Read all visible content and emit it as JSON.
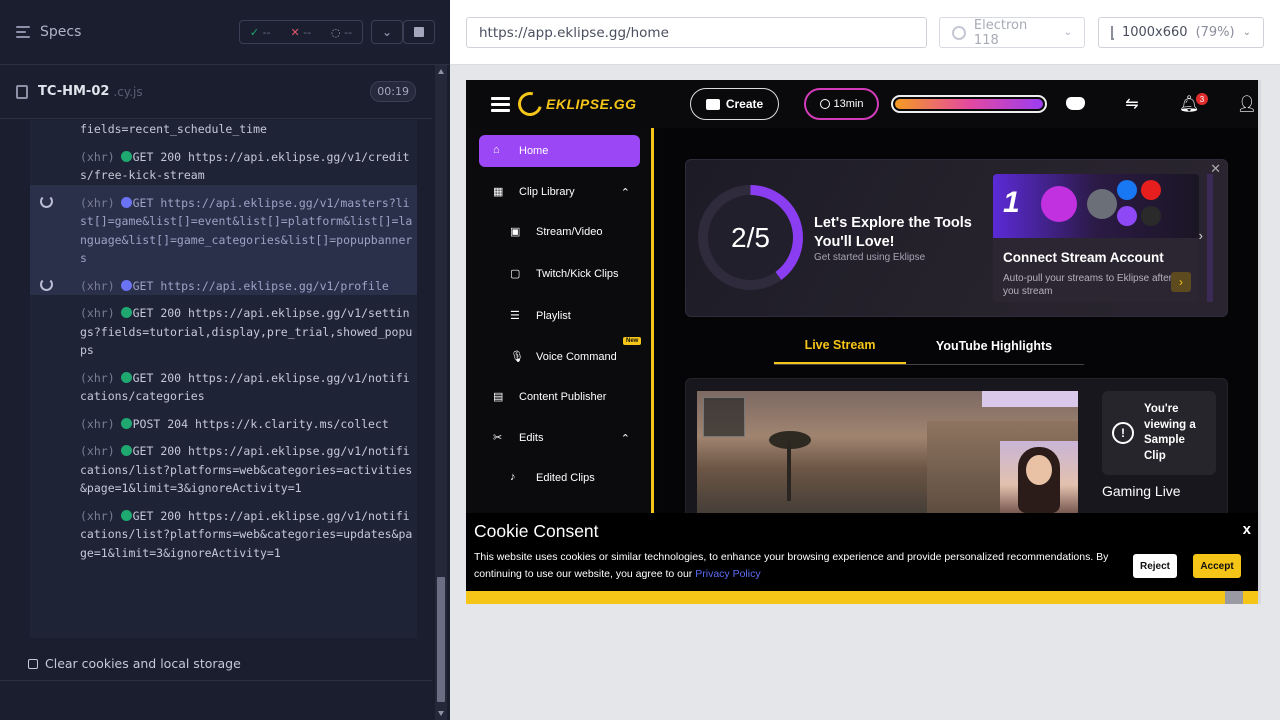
{
  "runner": {
    "specs_label": "Specs",
    "stats": {
      "passed": "--",
      "failed": "--",
      "pending": "--"
    },
    "spec_name": "TC-HM-02",
    "spec_ext": ".cy.js",
    "duration": "00:19",
    "clear_label": "Clear cookies and local storage",
    "logs": [
      {
        "kind": "",
        "status": "",
        "text": "fields=recent_schedule_time",
        "pending": false,
        "continuation": true
      },
      {
        "kind": "(xhr)",
        "status": "GET 200",
        "text": "https://api.eklipse.gg/v1/credits/free-kick-stream",
        "pending": false
      },
      {
        "kind": "(xhr)",
        "status": "GET",
        "text": "https://api.eklipse.gg/v1/masters?list[]=game&list[]=event&list[]=platform&list[]=language&list[]=game_categories&list[]=popupbanners",
        "pending": true
      },
      {
        "kind": "(xhr)",
        "status": "GET",
        "text": "https://api.eklipse.gg/v1/profile",
        "pending": true
      },
      {
        "kind": "(xhr)",
        "status": "GET 200",
        "text": "https://api.eklipse.gg/v1/settings?fields=tutorial,display,pre_trial,showed_popups",
        "pending": false
      },
      {
        "kind": "(xhr)",
        "status": "GET 200",
        "text": "https://api.eklipse.gg/v1/notifications/categories",
        "pending": false
      },
      {
        "kind": "(xhr)",
        "status": "POST 204",
        "text": "https://k.clarity.ms/collect",
        "pending": false
      },
      {
        "kind": "(xhr)",
        "status": "GET 200",
        "text": "https://api.eklipse.gg/v1/notifications/list?platforms=web&categories=activities&page=1&limit=3&ignoreActivity=1",
        "pending": false
      },
      {
        "kind": "(xhr)",
        "status": "GET 200",
        "text": "https://api.eklipse.gg/v1/notifications/list?platforms=web&categories=updates&page=1&limit=3&ignoreActivity=1",
        "pending": false
      }
    ]
  },
  "aut": {
    "url": "https://app.eklipse.gg/home",
    "browser": "Electron 118",
    "viewport": "1000x660",
    "zoom": "(79%)"
  },
  "app": {
    "logo": "EKLIPSE.GG",
    "create_label": "Create",
    "timer": "13min",
    "bell_count": "3",
    "nav": [
      {
        "label": "Home",
        "active": true
      },
      {
        "label": "Clip Library",
        "expandable": true
      },
      {
        "label": "Stream/Video",
        "sub": true
      },
      {
        "label": "Twitch/Kick Clips",
        "sub": true
      },
      {
        "label": "Playlist",
        "sub": true
      },
      {
        "label": "Voice Command",
        "sub": true,
        "badge": "New"
      },
      {
        "label": "Content Publisher"
      },
      {
        "label": "Edits",
        "expandable": true
      },
      {
        "label": "Edited Clips",
        "sub": true
      }
    ],
    "explore": {
      "progress": "2/5",
      "title": "Let's Explore the Tools You'll Love!",
      "subtitle": "Get started using Eklipse",
      "card_number": "1",
      "card_title": "Connect Stream Account",
      "card_desc": "Auto-pull your streams to Eklipse after you stream"
    },
    "tabs": [
      "Live Stream",
      "YouTube Highlights"
    ],
    "sample_text": "You're viewing a Sample Clip",
    "gaming_live": "Gaming Live",
    "cookie": {
      "title": "Cookie Consent",
      "close": "x",
      "text": "This website uses cookies or similar technologies, to enhance your browsing experience and provide personalized recommendations. By continuing to use our website, you agree to our",
      "link": "Privacy Policy",
      "reject": "Reject",
      "accept": "Accept"
    }
  }
}
